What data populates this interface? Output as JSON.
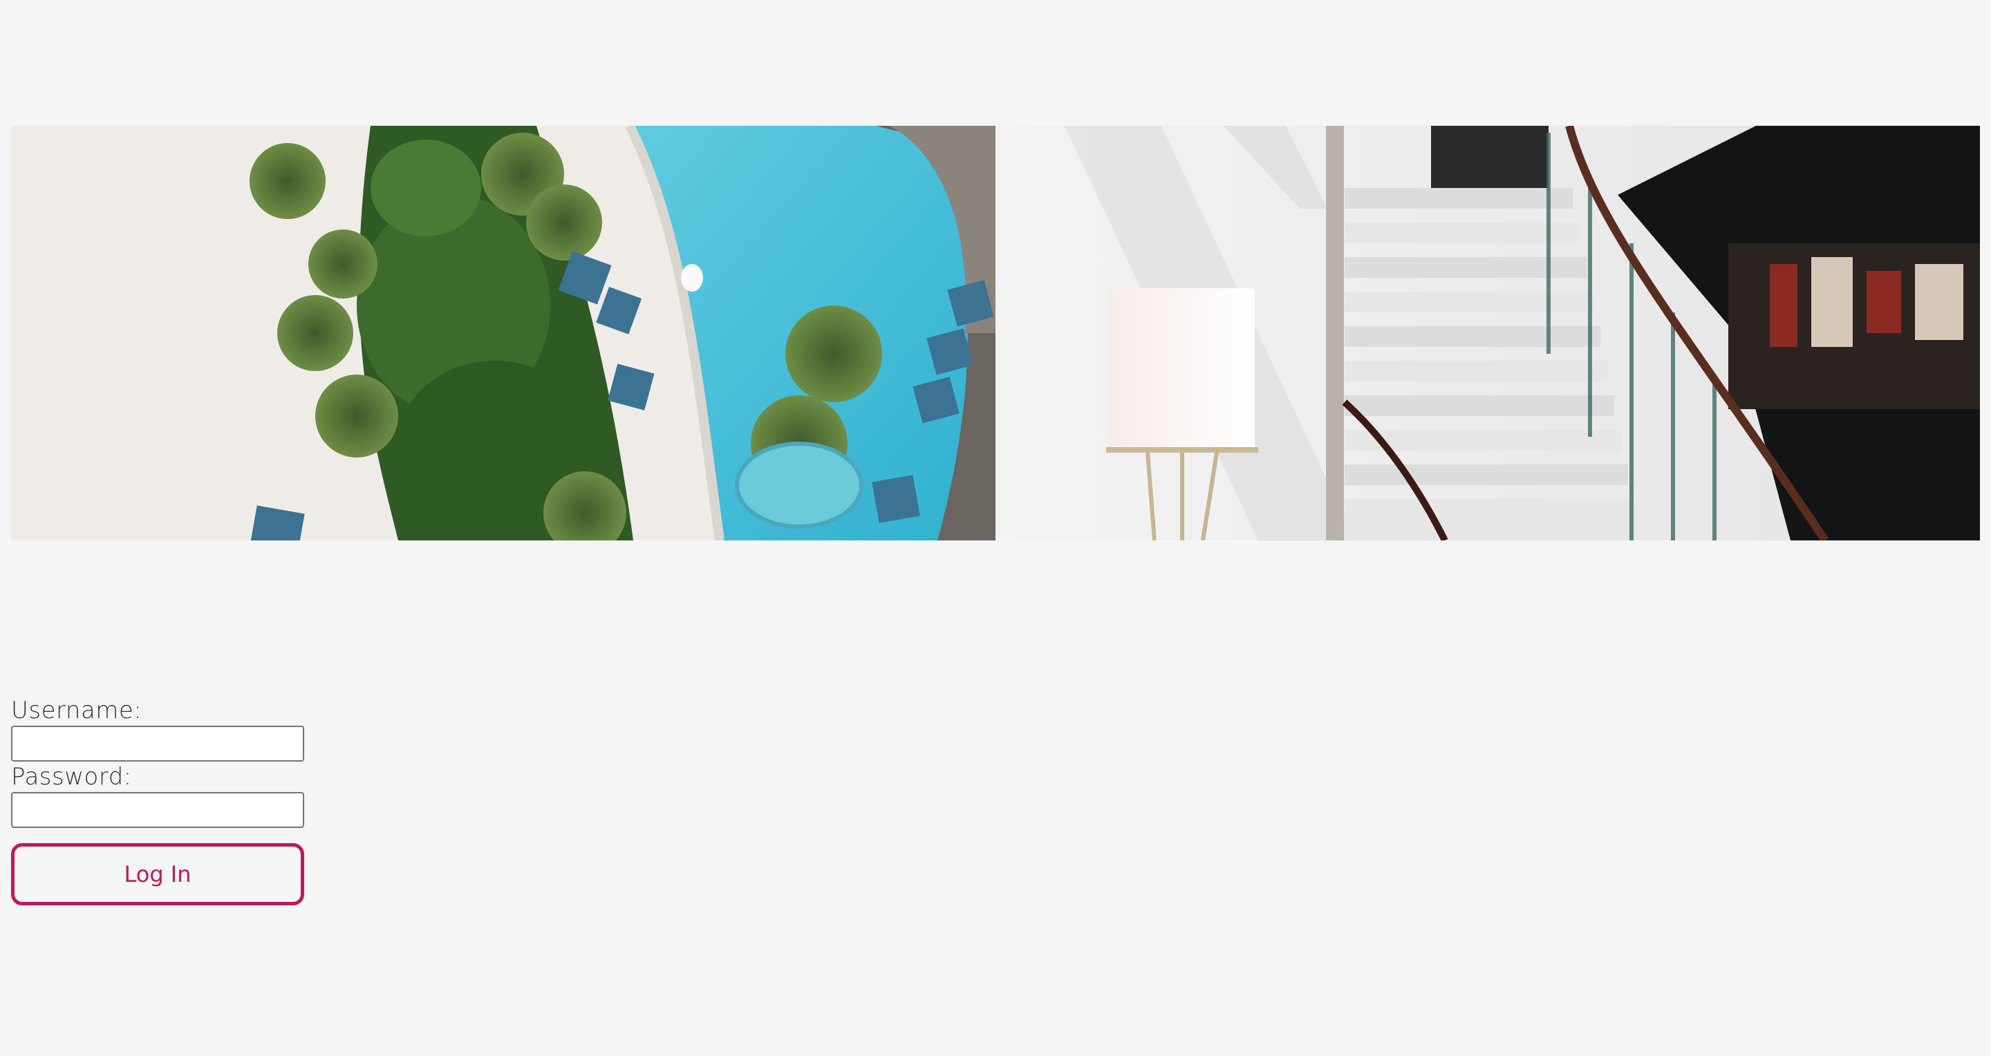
{
  "banner": {
    "images": [
      {
        "name": "resort-pool-aerial-photo"
      },
      {
        "name": "hotel-staircase-lobby-photo"
      }
    ]
  },
  "login": {
    "username_label": "Username:",
    "username_value": "",
    "password_label": "Password:",
    "password_value": "",
    "submit_label": "Log In"
  },
  "colors": {
    "background": "#f5f5f5",
    "accent": "#c2185b"
  }
}
